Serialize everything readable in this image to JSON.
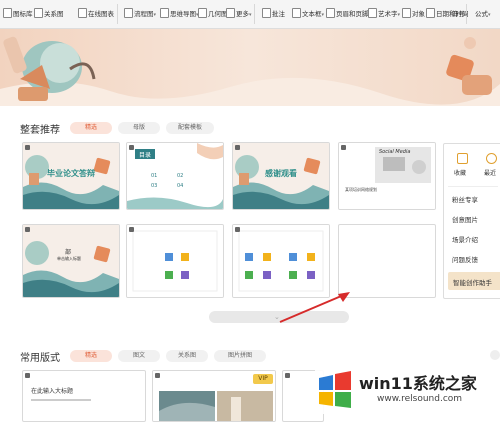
{
  "toolbar": {
    "items": [
      {
        "label": "图标库"
      },
      {
        "label": "关系图"
      },
      {
        "label": "在线图表"
      },
      {
        "label": "流程图"
      },
      {
        "label": "思维导图"
      },
      {
        "label": "几何图"
      },
      {
        "label": "更多"
      },
      {
        "label": "批注"
      },
      {
        "label": "文本框"
      },
      {
        "label": "页眉和页脚"
      },
      {
        "label": "艺术字"
      },
      {
        "label": "对象"
      },
      {
        "label": "日期和时间"
      },
      {
        "label": "符号"
      },
      {
        "label": "公式"
      }
    ]
  },
  "recommended": {
    "title": "整套推荐",
    "tabs": [
      "精选",
      "母版",
      "配套模板"
    ],
    "cards": [
      {
        "title": "毕业论文答辩",
        "sub": ""
      },
      {
        "title": "目录",
        "items": [
          "01",
          "02",
          "03",
          "04"
        ]
      },
      {
        "title": "感谢观看",
        "sub": ""
      },
      {
        "title": "Social Media",
        "sub": "某项培训网络规划"
      },
      {
        "title": "部",
        "sub": "单击输入标题"
      },
      {
        "title": "",
        "sub": ""
      },
      {
        "title": "",
        "sub": ""
      },
      {
        "title": "",
        "sub": ""
      }
    ]
  },
  "side_panel": {
    "top": [
      "收藏",
      "最近"
    ],
    "items": [
      "粉丝专享",
      "创意图片",
      "场景介绍",
      "问题反馈",
      "智能创作助手"
    ]
  },
  "common": {
    "title": "常用版式",
    "tabs": [
      "精选",
      "图文",
      "关系图",
      "图片拼图"
    ],
    "vip": "VIP",
    "card1_title": "在此输入大标题"
  },
  "watermark": {
    "brand": "win11系统之家",
    "url": "www.relsound.com"
  },
  "colors": {
    "accent": "#e0603b",
    "arrow": "#d62b2b",
    "banner_bg": "#f3dccc",
    "teal": "#5aa8a8"
  }
}
